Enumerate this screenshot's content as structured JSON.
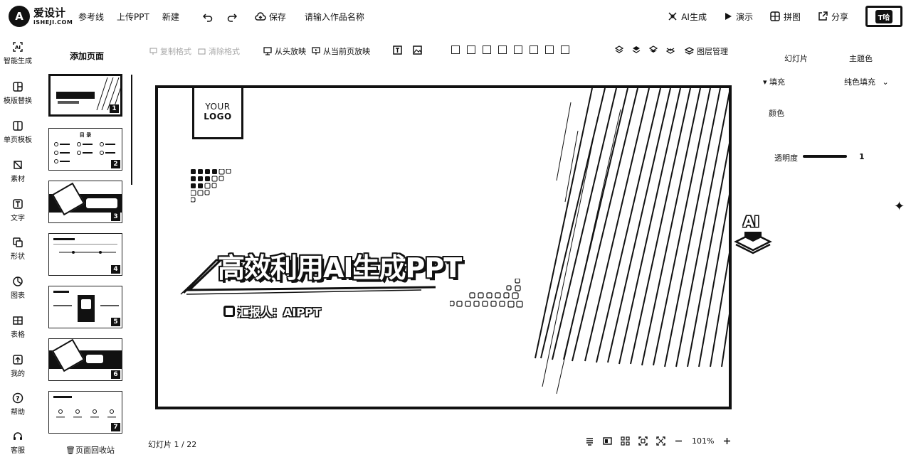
{
  "app": {
    "logo_mark": "A",
    "logo_cn": "爱设计",
    "logo_en": "iSHEJI.COM"
  },
  "top_menu": {
    "guides": "参考线",
    "upload_ppt": "上传PPT",
    "new": "新建",
    "save": "保存",
    "title_placeholder": "请输入作品名称"
  },
  "top_right": {
    "ai_generate": "AI生成",
    "present": "演示",
    "collage": "拼图",
    "share": "分享",
    "avatar_text": "T哈"
  },
  "rail": [
    {
      "label": "智能生成",
      "icon": "ai-icon"
    },
    {
      "label": "模版替换",
      "icon": "template-swap-icon"
    },
    {
      "label": "单页模板",
      "icon": "single-page-icon"
    },
    {
      "label": "素材",
      "icon": "material-icon"
    },
    {
      "label": "文字",
      "icon": "text-icon"
    },
    {
      "label": "形状",
      "icon": "shape-icon"
    },
    {
      "label": "图表",
      "icon": "chart-icon"
    },
    {
      "label": "表格",
      "icon": "table-icon"
    },
    {
      "label": "我的",
      "icon": "upload-icon"
    },
    {
      "label": "帮助",
      "icon": "help-icon"
    },
    {
      "label": "客服",
      "icon": "headset-icon"
    }
  ],
  "thumbnails": {
    "add_page": "添加页面",
    "recycle": "页面回收站",
    "pages": [
      "1",
      "2",
      "3",
      "4",
      "5",
      "6",
      "7"
    ],
    "toc_title": "目 录"
  },
  "toolbar": {
    "format_copy": "复制格式",
    "format_clear": "清除格式",
    "play_from_start": "从头放映",
    "play_from_current": "从当前页放映",
    "layer_manage": "图层管理"
  },
  "slide": {
    "logo_line1": "YOUR",
    "logo_line2": "LOGO",
    "title": "高效利用AI生成PPT",
    "reporter": "汇报人：AIPPT"
  },
  "status": {
    "slide_counter": "幻灯片 1 / 22",
    "zoom": "101%"
  },
  "right_panel": {
    "tab_slide": "幻灯片",
    "tab_theme": "主题色",
    "fill_label": "填充",
    "fill_value": "纯色填充",
    "color_label": "颜色",
    "opacity_label": "透明度",
    "opacity_value": "1"
  },
  "float": {
    "ai_label": "AI"
  }
}
